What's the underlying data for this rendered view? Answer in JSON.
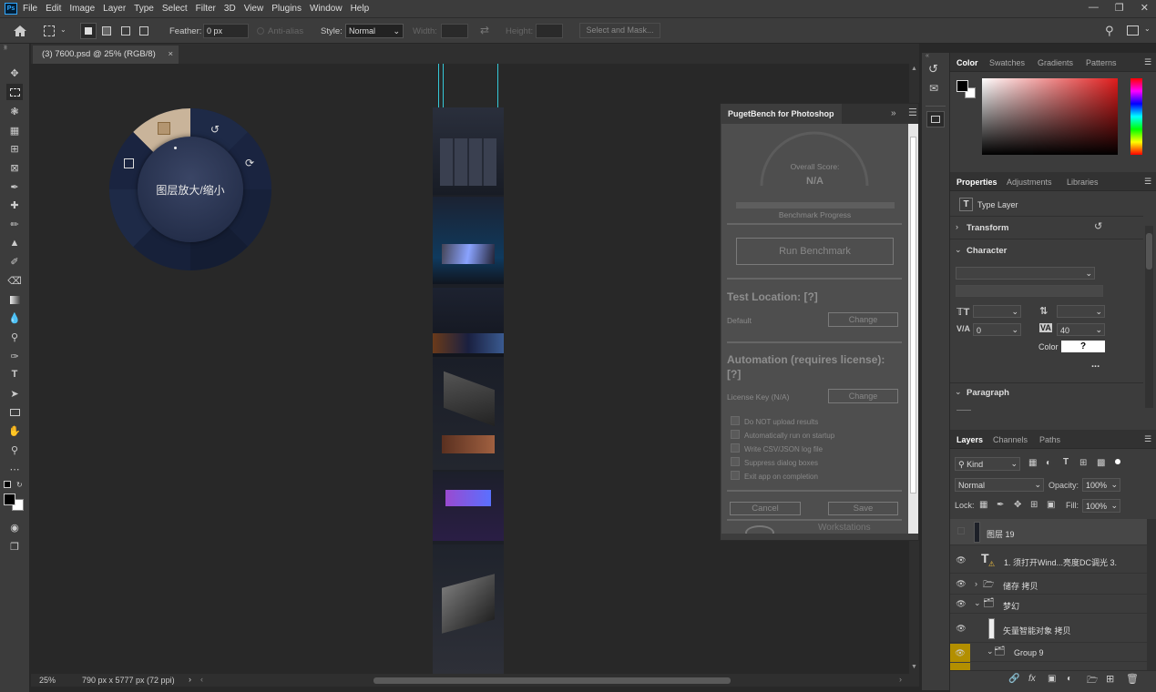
{
  "app": {
    "logo": "Ps"
  },
  "menu": [
    "File",
    "Edit",
    "Image",
    "Layer",
    "Type",
    "Select",
    "Filter",
    "3D",
    "View",
    "Plugins",
    "Window",
    "Help"
  ],
  "options": {
    "feather_label": "Feather:",
    "feather_value": "0 px",
    "antialias_label": "Anti-alias",
    "style_label": "Style:",
    "style_value": "Normal",
    "width_label": "Width:",
    "height_label": "Height:",
    "select_mask": "Select and Mask..."
  },
  "document": {
    "tab_title": "(3)  7600.psd @ 25% (RGB/8)",
    "close": "×"
  },
  "status": {
    "zoom": "25%",
    "info": "790 px x 5777 px (72 ppi)"
  },
  "radial_menu": {
    "center_label": "图层放大/缩小"
  },
  "puget": {
    "title": "PugetBench for Photoshop",
    "overall_score_label": "Overall Score:",
    "overall_score_value": "N/A",
    "progress_label": "Benchmark Progress",
    "run_button": "Run Benchmark",
    "test_location_heading": "Test Location: [?]",
    "location_value": "Default",
    "change_button": "Change",
    "automation_heading_1": "Automation (requires license):",
    "automation_heading_2": "[?]",
    "license_label": "License Key (N/A)",
    "change_button_2": "Change",
    "options": [
      "Do NOT upload results",
      "Automatically run on startup",
      "Write CSV/JSON log file",
      "Suppress dialog boxes",
      "Exit app on completion"
    ],
    "cancel": "Cancel",
    "save": "Save",
    "footer_brand": "Workstations"
  },
  "color_panel": {
    "tabs": [
      "Color",
      "Swatches",
      "Gradients",
      "Patterns"
    ]
  },
  "properties": {
    "tabs": [
      "Properties",
      "Adjustments",
      "Libraries"
    ],
    "type_label": "Type Layer",
    "transform": "Transform",
    "character": "Character",
    "tracking_value": "0",
    "kerning_value": "40",
    "color_label": "Color",
    "color_value": "?",
    "more": "...",
    "paragraph": "Paragraph"
  },
  "layers": {
    "tabs": [
      "Layers",
      "Channels",
      "Paths"
    ],
    "kind": "Kind",
    "blend": "Normal",
    "opacity_label": "Opacity:",
    "opacity_value": "100%",
    "lock_label": "Lock:",
    "fill_label": "Fill:",
    "fill_value": "100%",
    "rows": [
      {
        "name": "图层 19"
      },
      {
        "name": "1. 须打开Wind...亮度DC调光 3."
      },
      {
        "name": "储存 拷贝"
      },
      {
        "name": "梦幻"
      },
      {
        "name": "矢量智能对象 拷贝"
      },
      {
        "name": "Group 9"
      }
    ]
  },
  "colors": {
    "accent": "#31a8ff",
    "guide": "#35c8d8",
    "highlight_eye": "#b38f00"
  }
}
